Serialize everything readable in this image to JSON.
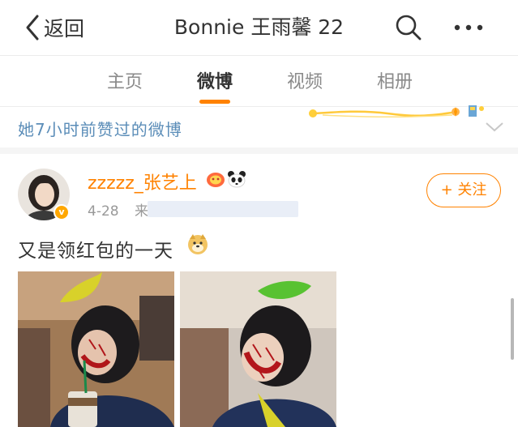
{
  "header": {
    "back_label": "返回",
    "title": "Bonnie 王雨馨 22",
    "search_icon": "search-icon",
    "more_icon": "more-icon"
  },
  "tabs": [
    {
      "label": "主页",
      "active": false
    },
    {
      "label": "微博",
      "active": true
    },
    {
      "label": "视频",
      "active": false
    },
    {
      "label": "相册",
      "active": false
    }
  ],
  "liked_notice": {
    "text": "她7小时前赞过的微博",
    "collapse_icon": "chevron-down-icon"
  },
  "post": {
    "username": "zzzzz_张艺上",
    "verified_badge": "v",
    "date": "4-28",
    "source_prefix": "来",
    "follow_label": "+ 关注",
    "text": "又是领红包的一天",
    "images": [
      "photo-1",
      "photo-2"
    ]
  },
  "colors": {
    "accent": "#ff8200",
    "link": "#5b8db8",
    "meta": "#999999",
    "separator": "#ececec"
  }
}
